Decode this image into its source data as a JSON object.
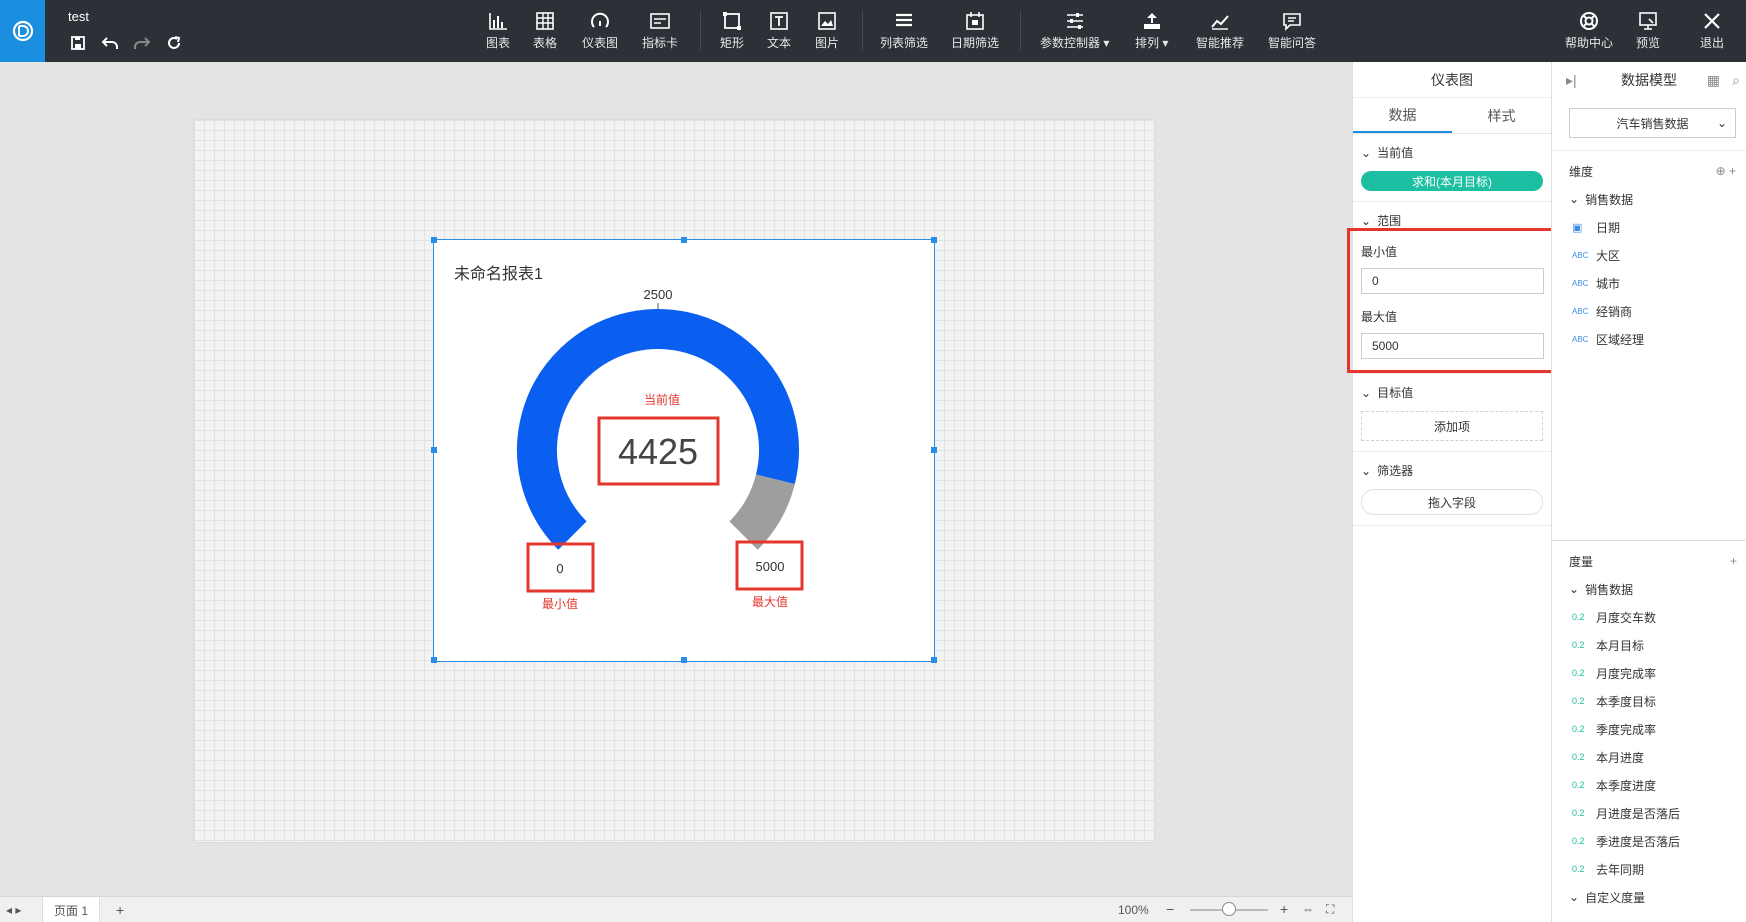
{
  "app": {
    "doc_title": "test"
  },
  "toolbar": {
    "items": [
      {
        "label": "图表"
      },
      {
        "label": "表格"
      },
      {
        "label": "仪表图"
      },
      {
        "label": "指标卡"
      },
      {
        "label": "矩形"
      },
      {
        "label": "文本"
      },
      {
        "label": "图片"
      },
      {
        "label": "列表筛选"
      },
      {
        "label": "日期筛选"
      },
      {
        "label": "参数控制器"
      },
      {
        "label": "排列"
      },
      {
        "label": "智能推荐"
      },
      {
        "label": "智能问答"
      }
    ],
    "right": [
      {
        "label": "帮助中心"
      },
      {
        "label": "预览"
      },
      {
        "label": "退出"
      }
    ]
  },
  "widget": {
    "title": "未命名报表1",
    "gauge": {
      "min": 0,
      "max": 5000,
      "value": 4425,
      "mid_label": "2500",
      "min_label": "0",
      "max_label": "5000",
      "value_caption": "当前值",
      "min_caption": "最小值",
      "max_caption": "最大值",
      "fill_color": "#0a5ff0",
      "rest_color": "#9e9e9e",
      "annotation_color": "#e3362d"
    }
  },
  "prop_panel": {
    "title": "仪表图",
    "tabs": [
      "数据",
      "样式"
    ],
    "current_value": {
      "header": "当前值",
      "field": "求和(本月目标)"
    },
    "range": {
      "header": "范围",
      "min_label": "最小值",
      "min_value": "0",
      "max_label": "最大值",
      "max_value": "5000"
    },
    "target": {
      "header": "目标值",
      "add_label": "添加项"
    },
    "filter": {
      "header": "筛选器",
      "drag_label": "拖入字段"
    }
  },
  "model_panel": {
    "title": "数据模型",
    "dataset": "汽车销售数据",
    "dimensions": {
      "header": "维度",
      "group": "销售数据",
      "items": [
        {
          "type": "date",
          "label": "日期"
        },
        {
          "type": "ABC",
          "label": "大区"
        },
        {
          "type": "ABC",
          "label": "城市"
        },
        {
          "type": "ABC",
          "label": "经销商"
        },
        {
          "type": "ABC",
          "label": "区域经理"
        }
      ]
    },
    "measures": {
      "header": "度量",
      "group": "销售数据",
      "items": [
        {
          "type": "0.2",
          "label": "月度交车数"
        },
        {
          "type": "0.2",
          "label": "本月目标"
        },
        {
          "type": "0.2",
          "label": "月度完成率"
        },
        {
          "type": "0.2",
          "label": "本季度目标"
        },
        {
          "type": "0.2",
          "label": "季度完成率"
        },
        {
          "type": "0.2",
          "label": "本月进度"
        },
        {
          "type": "0.2",
          "label": "本季度进度"
        },
        {
          "type": "0.2",
          "label": "月进度是否落后"
        },
        {
          "type": "0.2",
          "label": "季进度是否落后"
        },
        {
          "type": "0.2",
          "label": "去年同期"
        }
      ],
      "custom_group": "自定义度量"
    }
  },
  "bottom": {
    "page_tab": "页面 1",
    "add": "+",
    "zoom": "100%"
  }
}
